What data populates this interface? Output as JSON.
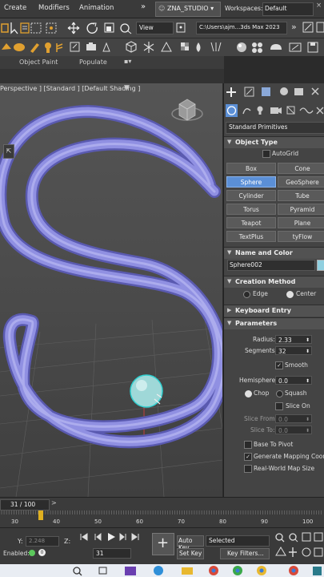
{
  "menubar": {
    "items": [
      "Create",
      "Modifiers",
      "Animation"
    ],
    "overflow_icon": "double-chevron-icon",
    "workspace_tab": "ZNA_STUDIO ▾",
    "workspaces_label": "Workspaces:",
    "workspace_value": "Default"
  },
  "toolbar": {
    "view_dropdown": "View",
    "path_field": "C:\\Users\\ajm...3ds Max 2023"
  },
  "ribbon": {
    "object_paint": "Object Paint",
    "populate": "Populate"
  },
  "viewport": {
    "label": "Perspective ] [Standard ] [Default Shading ]",
    "accent": "#8f8fe0"
  },
  "command_panel": {
    "category_dropdown": "Standard Primitives",
    "object_type": {
      "title": "Object Type",
      "autogrid": "AutoGrid",
      "buttons": [
        "Box",
        "Cone",
        "Sphere",
        "GeoSphere",
        "Cylinder",
        "Tube",
        "Torus",
        "Pyramid",
        "Teapot",
        "Plane",
        "TextPlus",
        "tyFlow"
      ],
      "selected": "Sphere"
    },
    "name_and_color": {
      "title": "Name and Color",
      "name": "Sphere002"
    },
    "creation_method": {
      "title": "Creation Method",
      "edge": "Edge",
      "center": "Center"
    },
    "keyboard_entry": {
      "title": "Keyboard Entry"
    },
    "parameters": {
      "title": "Parameters",
      "radius_label": "Radius:",
      "radius": "2.33",
      "segments_label": "Segments:",
      "segments": "32",
      "smooth": "Smooth",
      "hemisphere_label": "Hemisphere:",
      "hemisphere": "0.0",
      "chop": "Chop",
      "squash": "Squash",
      "slice_on": "Slice On",
      "slice_from_label": "Slice From:",
      "slice_from": "0.0",
      "slice_to_label": "Slice To:",
      "slice_to": "0.0",
      "base_to_pivot": "Base To Pivot",
      "gen_mapping": "Generate Mapping Coords",
      "real_world": "Real-World Map Size"
    }
  },
  "timeline": {
    "frame_readout": "31 / 100",
    "ticks": [
      "30",
      "40",
      "50",
      "60",
      "70",
      "80",
      "90",
      "100"
    ]
  },
  "bottom": {
    "y_label": "Y:",
    "y_value": "2.248",
    "z_label": "Z:",
    "enabled_label": "Enabled:",
    "frame_field": "31",
    "auto_key": "Auto Key",
    "selected_dropdown": "Selected",
    "set_key": "Set Key",
    "key_filters": "Key Filters..."
  }
}
